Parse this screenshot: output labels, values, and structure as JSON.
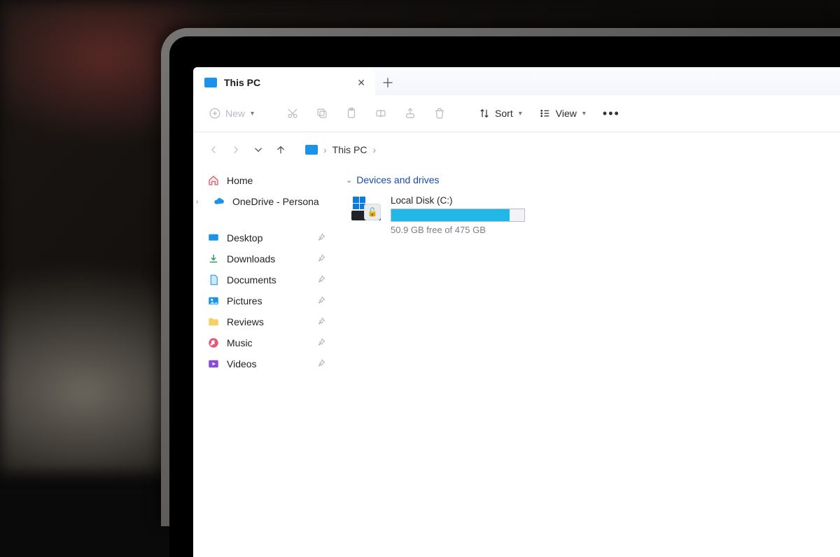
{
  "tab": {
    "title": "This PC"
  },
  "toolbar": {
    "new_label": "New",
    "sort_label": "Sort",
    "view_label": "View"
  },
  "breadcrumb": {
    "root": "This PC"
  },
  "sidebar": {
    "home": "Home",
    "onedrive": "OneDrive - Persona",
    "quick": [
      {
        "label": "Desktop"
      },
      {
        "label": "Downloads"
      },
      {
        "label": "Documents"
      },
      {
        "label": "Pictures"
      },
      {
        "label": "Reviews"
      },
      {
        "label": "Music"
      },
      {
        "label": "Videos"
      }
    ]
  },
  "content": {
    "section_label": "Devices and drives",
    "drive": {
      "name": "Local Disk (C:)",
      "free_text": "50.9 GB free of 475 GB",
      "used_percent": 89
    }
  }
}
